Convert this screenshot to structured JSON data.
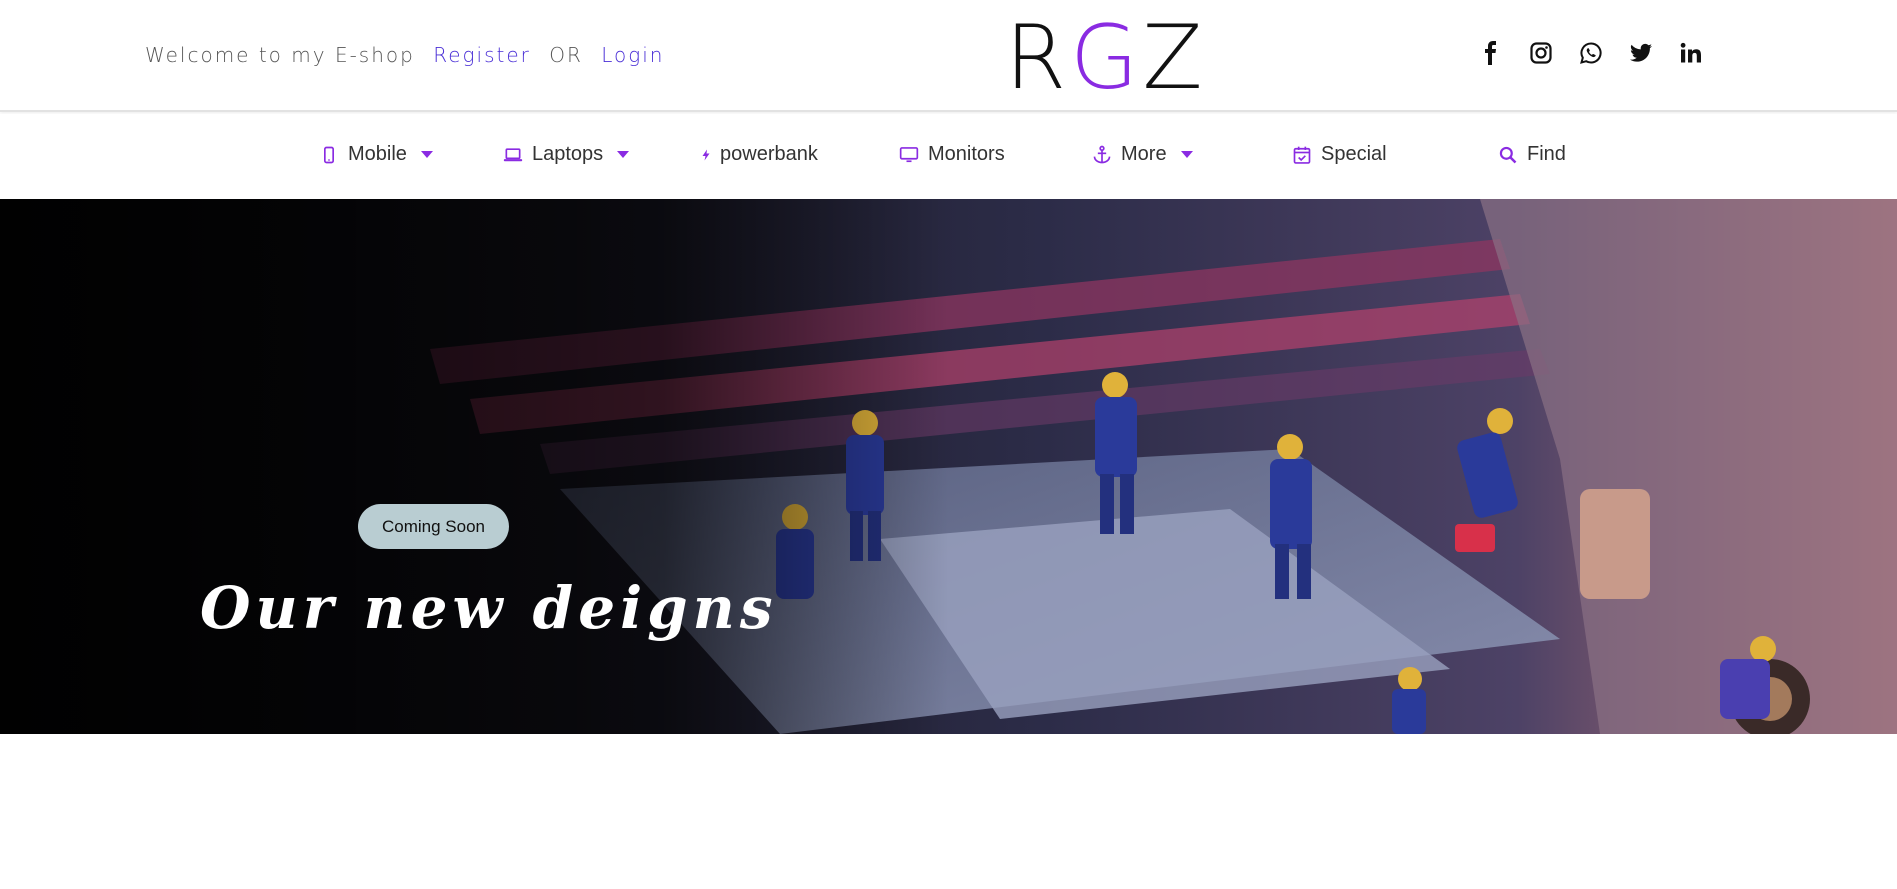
{
  "header": {
    "welcome_text": "Welcome to my E-shop",
    "register_label": "Register",
    "or_text": "OR",
    "login_label": "Login",
    "logo_left": "R",
    "logo_accent": "G",
    "logo_right": "Z",
    "social": [
      "facebook-icon",
      "instagram-icon",
      "whatsapp-icon",
      "twitter-icon",
      "linkedin-icon"
    ]
  },
  "nav": {
    "items": [
      {
        "label": "Mobile",
        "icon": "mobile-icon",
        "dropdown": true
      },
      {
        "label": "Laptops",
        "icon": "laptop-icon",
        "dropdown": true
      },
      {
        "label": "powerbank",
        "icon": "bolt-icon",
        "dropdown": false
      },
      {
        "label": "Monitors",
        "icon": "monitor-icon",
        "dropdown": false
      },
      {
        "label": "More",
        "icon": "anchor-icon",
        "dropdown": true
      },
      {
        "label": "Special",
        "icon": "calendar-check-icon",
        "dropdown": false
      },
      {
        "label": "Find",
        "icon": "search-icon",
        "dropdown": false
      }
    ]
  },
  "hero": {
    "badge_label": "Coming Soon",
    "title": "Our new deigns"
  },
  "colors": {
    "accent": "#8a2be2",
    "link": "#4a2fd6",
    "badge_bg": "#b9cdd2"
  }
}
